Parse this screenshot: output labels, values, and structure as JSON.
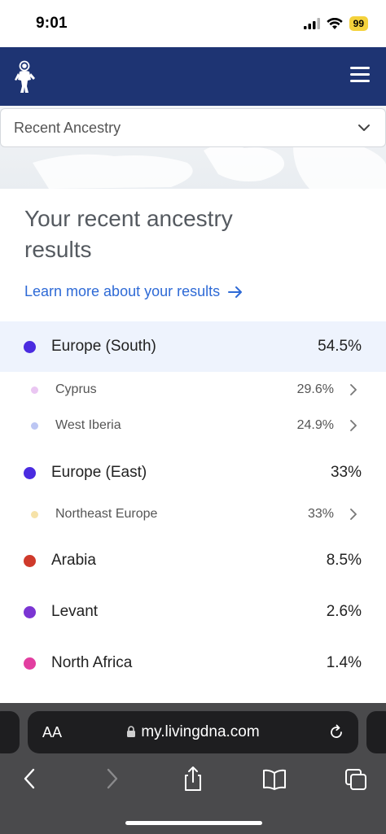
{
  "status_bar": {
    "time": "9:01",
    "battery": "99"
  },
  "header": {
    "logo_icon": "astronaut-logo-icon",
    "menu_icon": "hamburger-menu-icon"
  },
  "dropdown": {
    "label": "Recent Ancestry",
    "icon": "chevron-down-icon"
  },
  "content": {
    "title": "Your recent ancestry results",
    "learn_more": "Learn more about your results",
    "regions": [
      {
        "name": "Europe (South)",
        "percent": "54.5%",
        "color": "#4a2be0"
      },
      {
        "name": "Cyprus",
        "percent": "29.6%",
        "color": "#eac6f2"
      },
      {
        "name": "West Iberia",
        "percent": "24.9%",
        "color": "#bcc6f3"
      },
      {
        "name": "Europe (East)",
        "percent": "33%",
        "color": "#4a2be0"
      },
      {
        "name": "Northeast Europe",
        "percent": "33%",
        "color": "#f6e2a8"
      },
      {
        "name": "Arabia",
        "percent": "8.5%",
        "color": "#cf3a2b"
      },
      {
        "name": "Levant",
        "percent": "2.6%",
        "color": "#7b35d3"
      },
      {
        "name": "North Africa",
        "percent": "1.4%",
        "color": "#e23ea0"
      }
    ]
  },
  "browser": {
    "aa_label": "AA",
    "url": "my.livingdna.com",
    "icons": [
      "back-icon",
      "forward-icon",
      "share-icon",
      "bookmarks-icon",
      "tabs-icon"
    ]
  }
}
